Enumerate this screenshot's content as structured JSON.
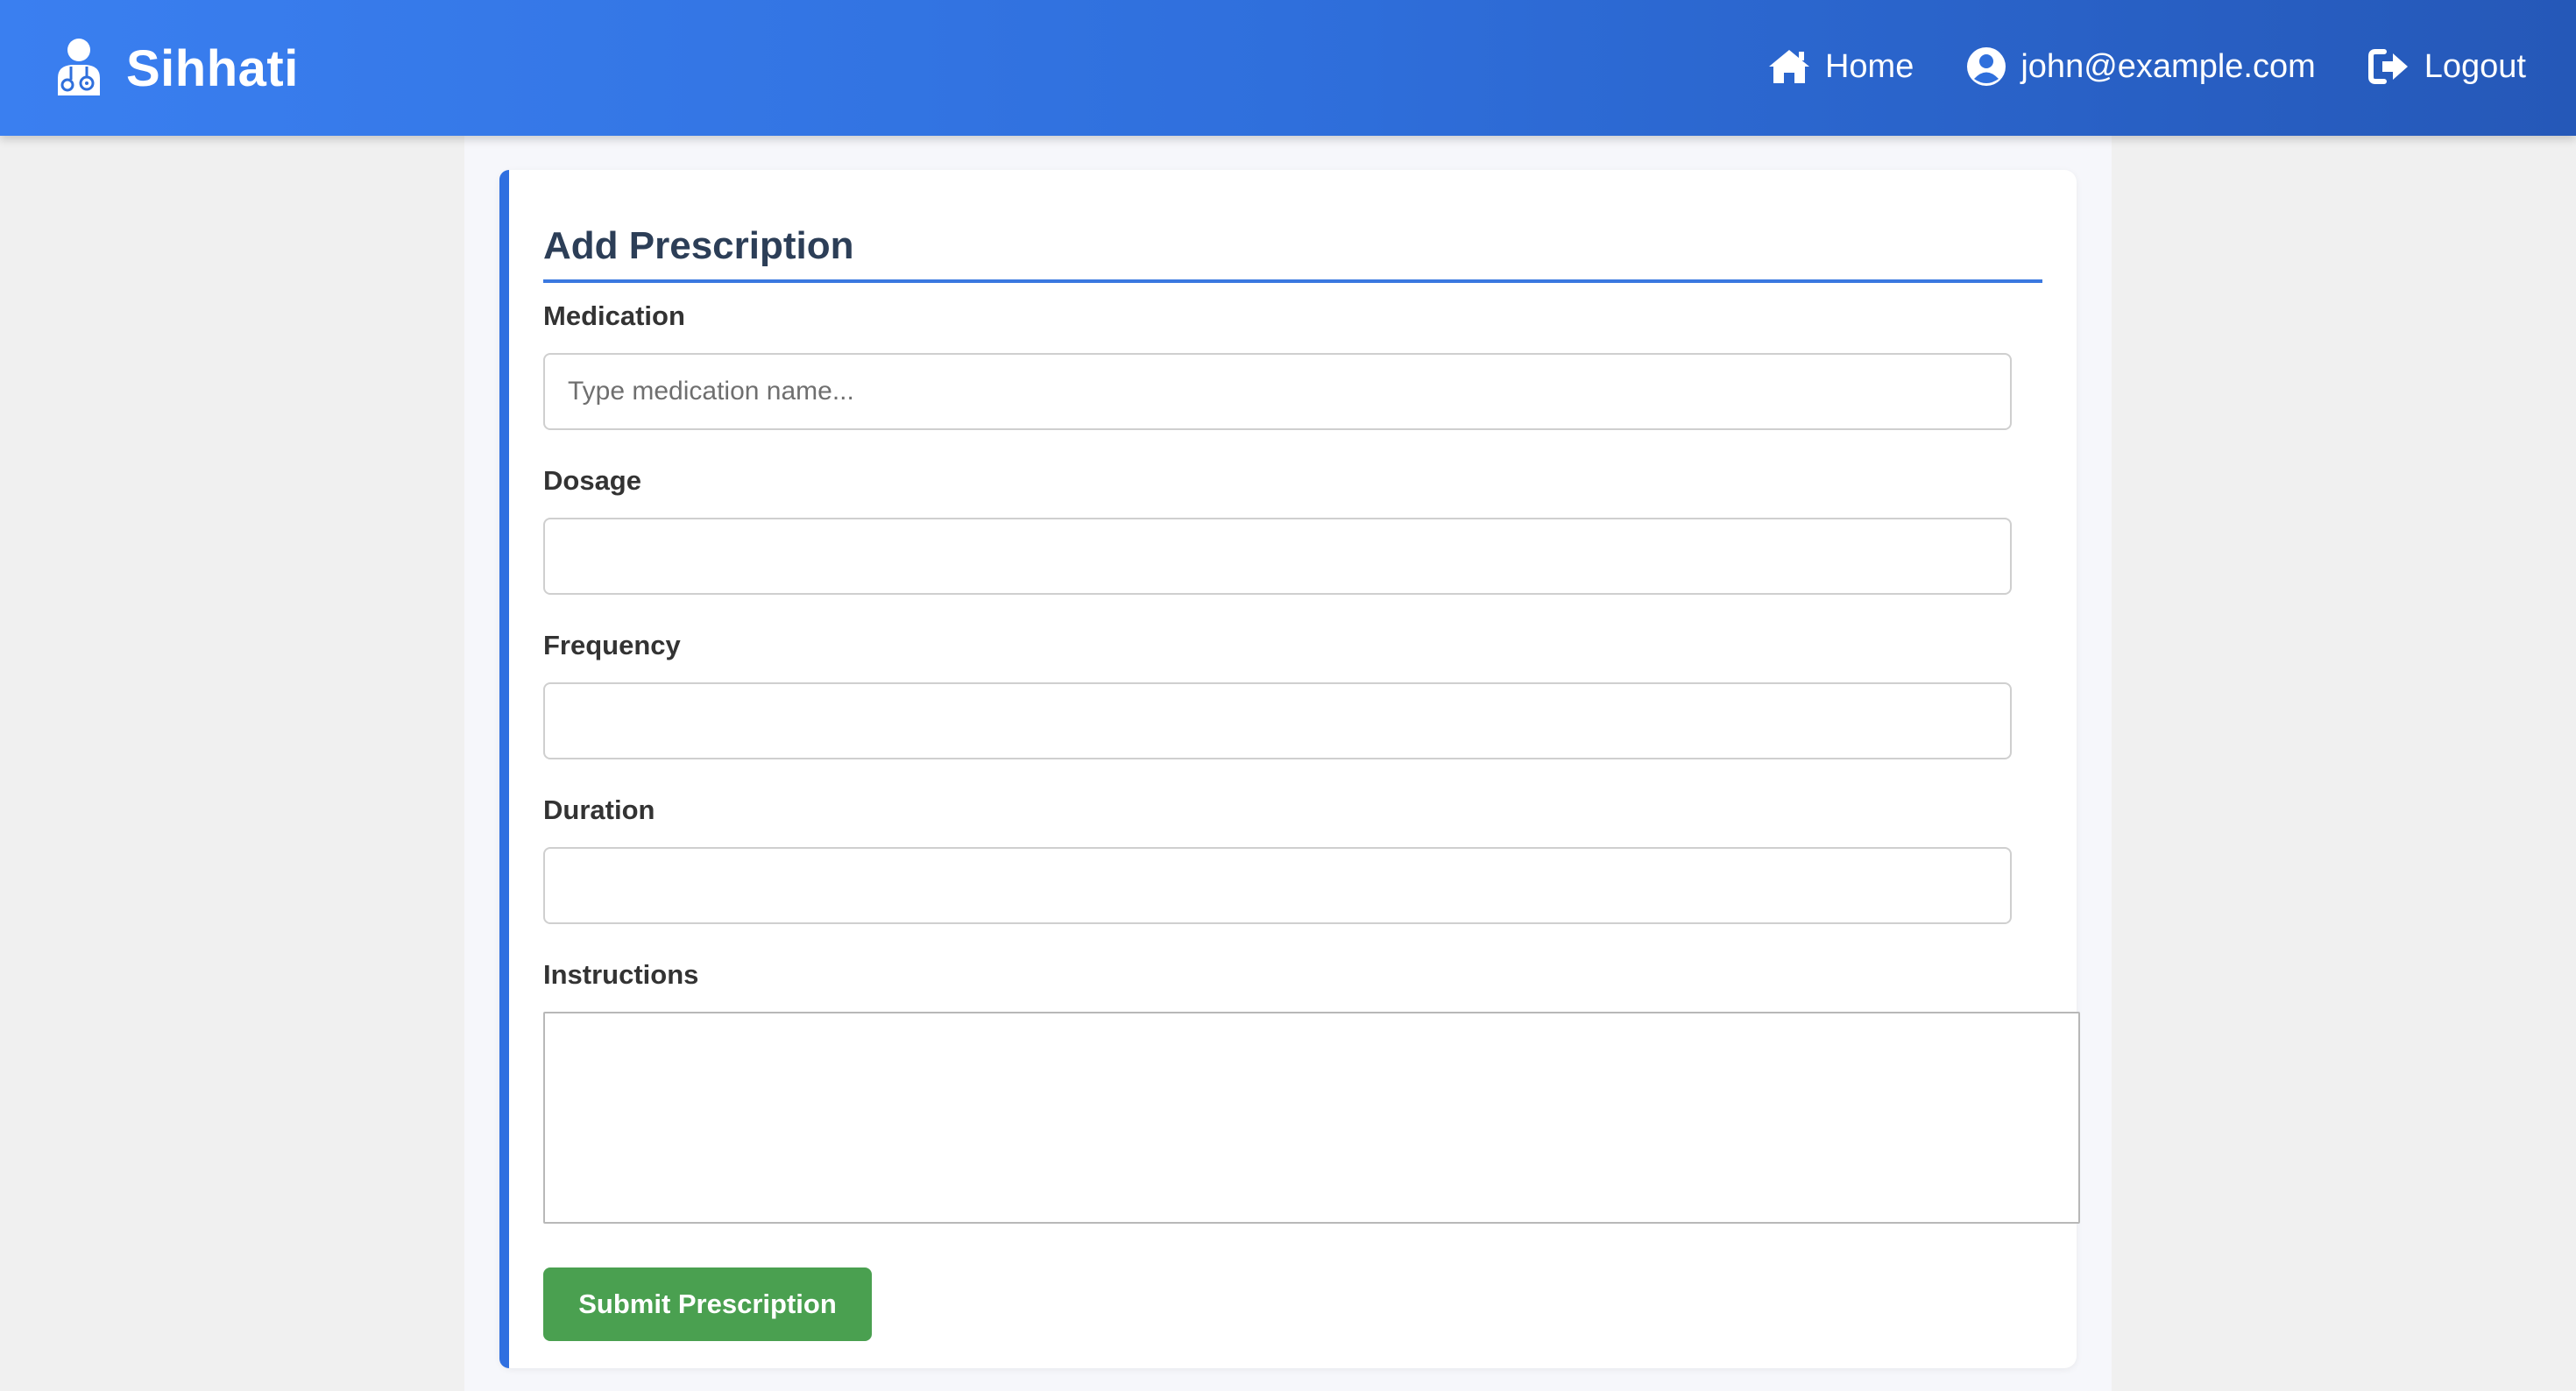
{
  "navbar": {
    "brand": "Sihhati",
    "brand_icon": "doctor-icon",
    "links": [
      {
        "label": "Home",
        "icon": "home-icon"
      },
      {
        "label": "john@example.com",
        "icon": "user-circle-icon"
      },
      {
        "label": "Logout",
        "icon": "logout-icon"
      }
    ]
  },
  "form": {
    "title": "Add Prescription",
    "fields": {
      "medication": {
        "label": "Medication",
        "placeholder": "Type medication name...",
        "value": ""
      },
      "dosage": {
        "label": "Dosage",
        "placeholder": "",
        "value": ""
      },
      "frequency": {
        "label": "Frequency",
        "placeholder": "",
        "value": ""
      },
      "duration": {
        "label": "Duration",
        "placeholder": "",
        "value": ""
      },
      "instructions": {
        "label": "Instructions",
        "placeholder": "",
        "value": ""
      }
    },
    "submit_label": "Submit Prescription"
  },
  "colors": {
    "navbar_gradient_start": "#3a7ff0",
    "navbar_gradient_end": "#2558b8",
    "accent": "#2f6fe0",
    "submit_button": "#4aa050",
    "title_text": "#2c3e57"
  }
}
